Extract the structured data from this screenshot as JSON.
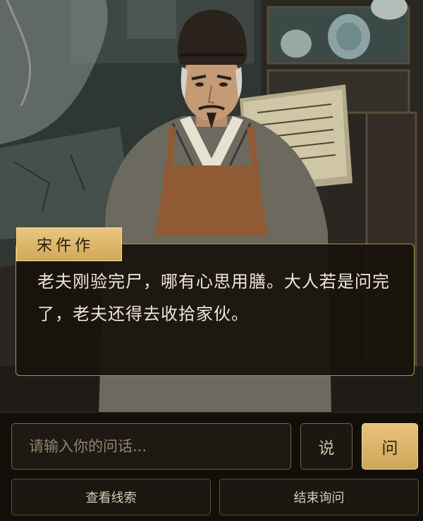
{
  "character": {
    "name": "宋仵作"
  },
  "dialogue": {
    "text": "老夫刚验完尸，哪有心思用膳。大人若是问完了，老夫还得去收拾家伙。"
  },
  "input": {
    "placeholder": "请输入你的问话..."
  },
  "actions": {
    "say_label": "说",
    "ask_label": "问",
    "view_clues_label": "查看线索",
    "end_interrogation_label": "结束询问"
  },
  "colors": {
    "accent_gold": "#d9b466",
    "panel_dark": "#18120c",
    "border_gold": "#b7924f"
  }
}
